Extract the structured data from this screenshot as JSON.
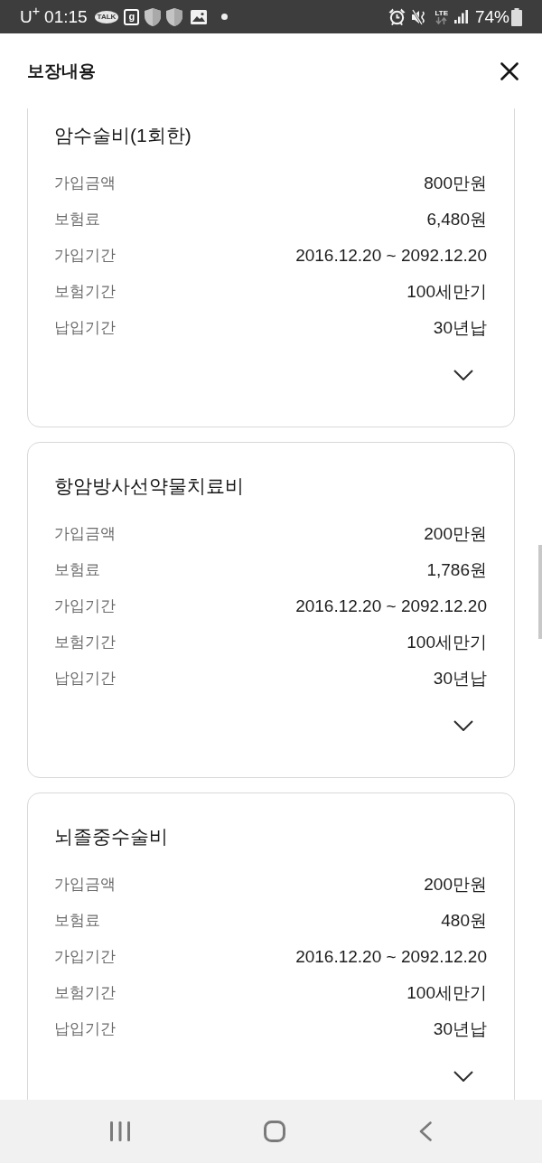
{
  "status_bar": {
    "carrier": "U$^{+}$",
    "time": "01:15",
    "chat_badge": "TALK",
    "app_badge": "g",
    "network_type": "LTE",
    "battery": "74%"
  },
  "header": {
    "title": "보장내용"
  },
  "cards": [
    {
      "title": "암수술비(1회한)",
      "rows": [
        {
          "label": "가입금액",
          "value": "800만원"
        },
        {
          "label": "보험료",
          "value": "6,480원"
        },
        {
          "label": "가입기간",
          "value": "2016.12.20 ~ 2092.12.20"
        },
        {
          "label": "보험기간",
          "value": "100세만기"
        },
        {
          "label": "납입기간",
          "value": "30년납"
        }
      ]
    },
    {
      "title": "항암방사선약물치료비",
      "rows": [
        {
          "label": "가입금액",
          "value": "200만원"
        },
        {
          "label": "보험료",
          "value": "1,786원"
        },
        {
          "label": "가입기간",
          "value": "2016.12.20 ~ 2092.12.20"
        },
        {
          "label": "보험기간",
          "value": "100세만기"
        },
        {
          "label": "납입기간",
          "value": "30년납"
        }
      ]
    },
    {
      "title": "뇌졸중수술비",
      "rows": [
        {
          "label": "가입금액",
          "value": "200만원"
        },
        {
          "label": "보험료",
          "value": "480원"
        },
        {
          "label": "가입기간",
          "value": "2016.12.20 ~ 2092.12.20"
        },
        {
          "label": "보험기간",
          "value": "100세만기"
        },
        {
          "label": "납입기간",
          "value": "30년납"
        }
      ]
    }
  ]
}
